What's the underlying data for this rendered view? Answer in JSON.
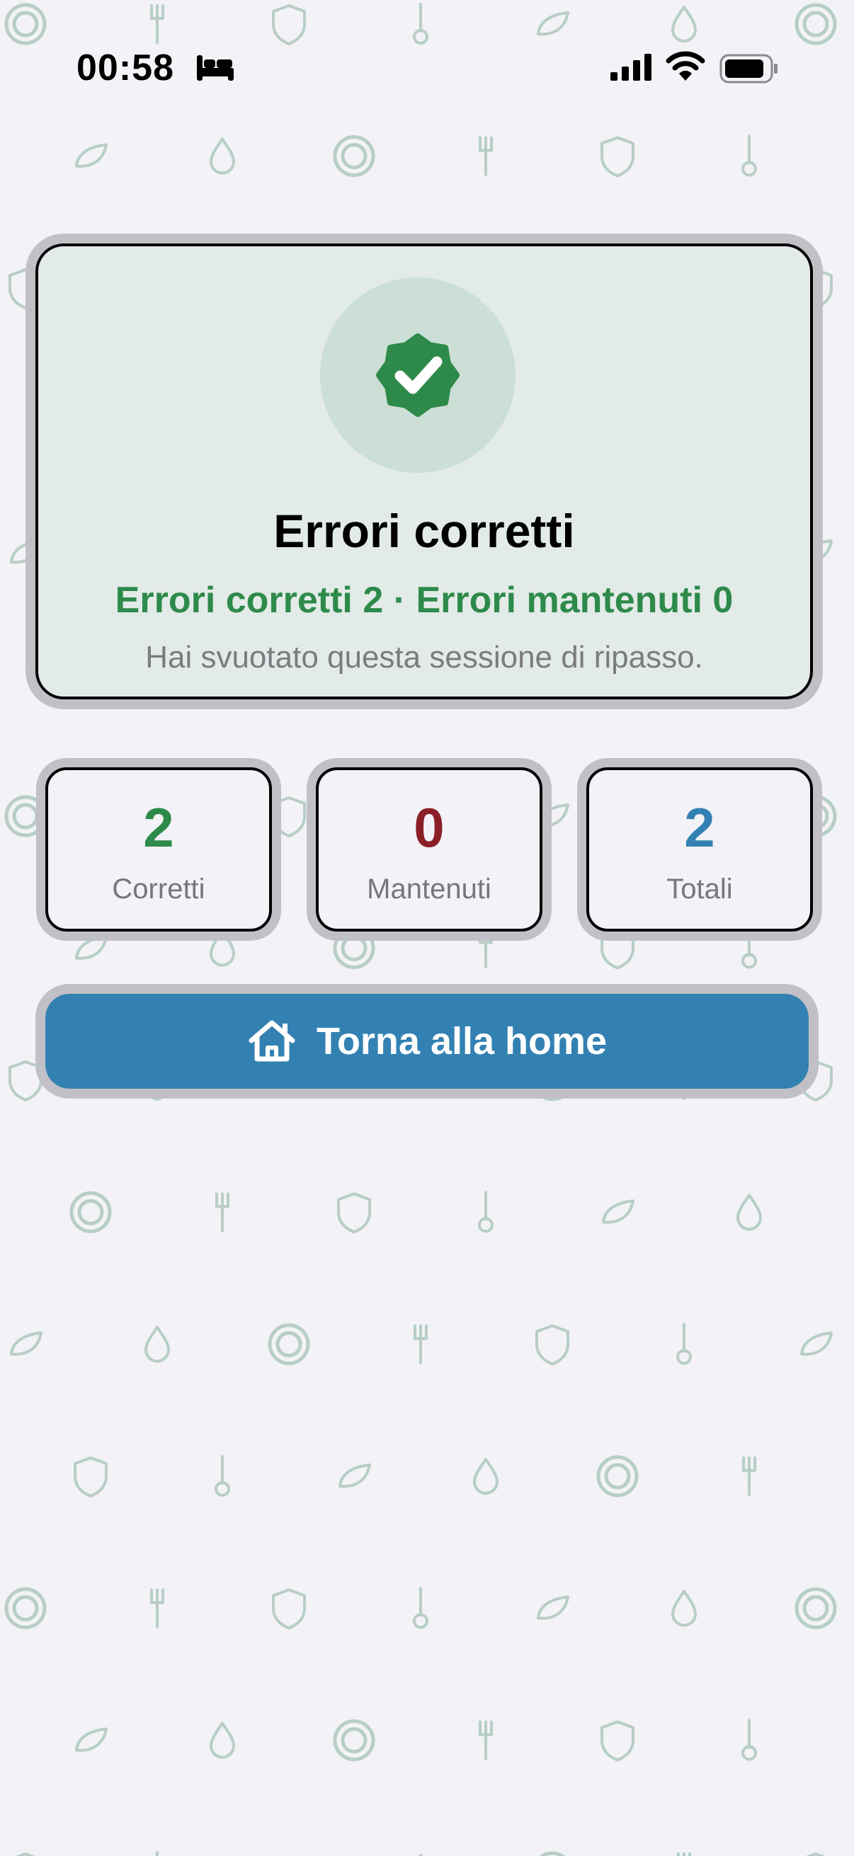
{
  "status_bar": {
    "time": "00:58",
    "icons": [
      "bed-icon",
      "cellular-signal-icon",
      "wifi-icon",
      "battery-icon"
    ]
  },
  "result_card": {
    "icon": "verified-badge-check-icon",
    "title": "Errori corretti",
    "summary": "Errori corretti 2 · Errori mantenuti 0",
    "subtitle": "Hai svuotato questa sessione di ripasso."
  },
  "stats": [
    {
      "value": "2",
      "label": "Corretti",
      "color": "#2e8a4a"
    },
    {
      "value": "0",
      "label": "Mantenuti",
      "color": "#8b1f27"
    },
    {
      "value": "2",
      "label": "Totali",
      "color": "#3381b2"
    }
  ],
  "home_button": {
    "label": "Torna alla home",
    "icon": "house-icon"
  },
  "background_pattern": {
    "icons": [
      "target-icon",
      "fork-icon",
      "shield-icon",
      "thermometer-icon",
      "leaf-icon",
      "drop-icon"
    ]
  },
  "colors": {
    "accent_green": "#2e8a4a",
    "accent_red": "#8b1f27",
    "accent_blue": "#3381b2",
    "card_bg": "#e2ebe8",
    "page_bg": "#f2f2f7",
    "pattern": "#b8cec5"
  }
}
